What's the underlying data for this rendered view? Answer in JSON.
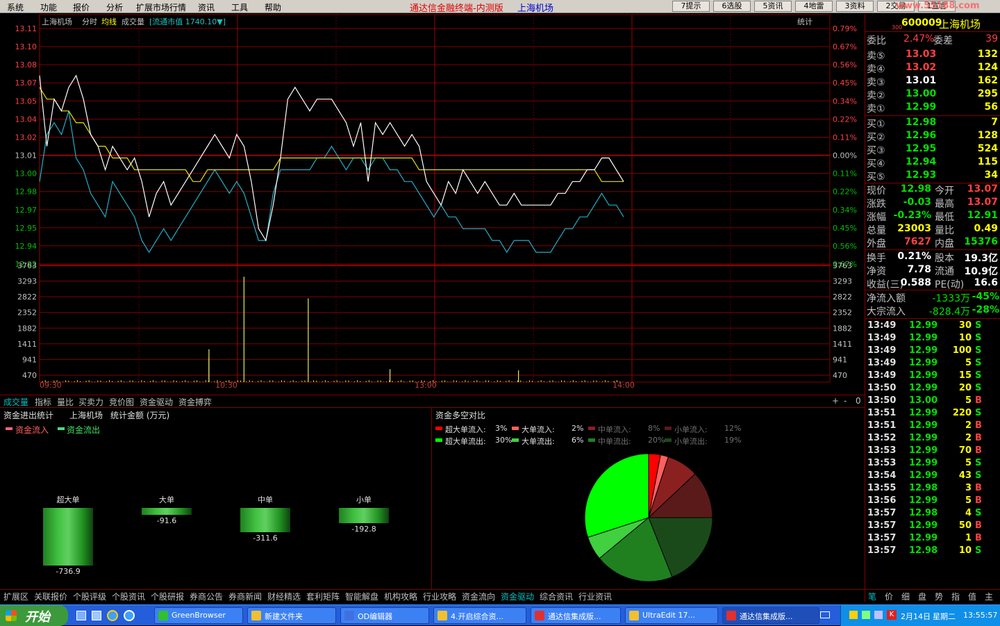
{
  "menu": [
    "系统",
    "功能",
    "报价",
    "分析",
    "扩展市场行情",
    "资讯",
    "工具",
    "帮助"
  ],
  "app_title": "通达信金融终端-内测版",
  "app_stock": "上海机场",
  "toolbar_buttons": [
    "7提示",
    "6选股",
    "5资讯",
    "4地雷",
    "3资料",
    "2交易",
    "1宣言"
  ],
  "watermark": "www.55188.com",
  "chart_header": {
    "name": "上海机场",
    "mode": "分时",
    "avg": "均线",
    "vol": "成交量",
    "mktcap": "[流通市值 1740.10▼]",
    "stat": "统计"
  },
  "chart_data": {
    "type": "line",
    "price_ticks_left": [
      "13.11",
      "13.10",
      "13.08",
      "13.07",
      "13.05",
      "13.04",
      "13.02",
      "13.01",
      "13.00",
      "12.98",
      "12.97",
      "12.95",
      "12.94",
      "12.92"
    ],
    "pct_ticks_right": [
      "0.79%",
      "0.67%",
      "0.56%",
      "0.45%",
      "0.34%",
      "0.22%",
      "0.11%",
      "0.00%",
      "0.11%",
      "0.22%",
      "0.34%",
      "0.45%",
      "0.56%",
      "0.67%"
    ],
    "vol_ticks": [
      "3763",
      "3293",
      "2822",
      "2352",
      "1882",
      "1411",
      "941",
      "470"
    ],
    "time_ticks": [
      "09:30",
      "10:30",
      "13:00",
      "14:00"
    ],
    "ylim": [
      12.91,
      13.11
    ],
    "ref_price": 13.01,
    "vol_max": 3763,
    "price_series": [
      13.07,
      13.01,
      13.05,
      13.04,
      13.06,
      13.07,
      13.05,
      13.02,
      13.01,
      12.99,
      13.01,
      13.0,
      12.99,
      13.0,
      12.98,
      12.95,
      12.97,
      12.98,
      12.96,
      12.97,
      12.98,
      12.99,
      13.0,
      13.01,
      13.02,
      13.01,
      13.0,
      13.02,
      13.01,
      12.98,
      12.94,
      12.93,
      12.96,
      13.0,
      13.05,
      13.06,
      13.05,
      13.04,
      13.05,
      13.05,
      13.05,
      13.04,
      13.03,
      13.01,
      13.03,
      12.98,
      13.03,
      13.02,
      13.03,
      13.02,
      13.01,
      13.02,
      13.01,
      12.98,
      12.97,
      12.96,
      12.98,
      12.97,
      12.99,
      12.98,
      12.97,
      12.98,
      12.97,
      12.96,
      12.96,
      12.97,
      12.96,
      12.96,
      12.96,
      12.96,
      12.96,
      12.97,
      12.97,
      12.98,
      12.98,
      12.99,
      12.99,
      13.0,
      13.0,
      12.99,
      12.98
    ],
    "avg_series": [
      13.06,
      13.05,
      13.05,
      13.04,
      13.04,
      13.03,
      13.03,
      13.02,
      13.01,
      13.01,
      13.0,
      13.0,
      13.0,
      12.99,
      12.99,
      12.99,
      12.99,
      12.99,
      12.99,
      12.99,
      12.99,
      12.98,
      12.98,
      12.99,
      12.99,
      12.99,
      12.99,
      12.99,
      12.99,
      12.99,
      12.99,
      12.99,
      12.99,
      13.0,
      13.0,
      13.0,
      13.0,
      13.0,
      13.0,
      13.0,
      13.0,
      13.0,
      13.0,
      13.0,
      13.0,
      13.0,
      13.0,
      13.0,
      13.0,
      13.0,
      13.0,
      13.0,
      12.99,
      12.99,
      12.99,
      12.99,
      12.99,
      12.99,
      12.99,
      12.99,
      12.99,
      12.99,
      12.99,
      12.99,
      12.99,
      12.99,
      12.99,
      12.99,
      12.99,
      12.99,
      12.99,
      12.99,
      12.99,
      12.99,
      12.99,
      12.99,
      12.99,
      12.98,
      12.98,
      12.98,
      12.98
    ],
    "leading_series": [
      12.98,
      13.02,
      13.03,
      13.02,
      13.04,
      13.0,
      12.99,
      12.97,
      12.96,
      12.95,
      12.98,
      12.97,
      12.96,
      12.95,
      12.93,
      12.92,
      12.93,
      12.94,
      12.93,
      12.94,
      12.95,
      12.96,
      12.97,
      12.98,
      12.99,
      12.98,
      12.97,
      12.98,
      12.97,
      12.95,
      12.93,
      12.93,
      12.97,
      12.99,
      12.99,
      12.99,
      12.99,
      12.99,
      13.0,
      13.0,
      13.01,
      13.0,
      12.99,
      13.0,
      13.0,
      12.99,
      13.0,
      13.0,
      12.99,
      12.99,
      12.98,
      12.98,
      12.97,
      12.96,
      12.95,
      12.96,
      12.95,
      12.95,
      12.94,
      12.94,
      12.94,
      12.94,
      12.93,
      12.93,
      12.92,
      12.93,
      12.93,
      12.93,
      12.92,
      12.92,
      12.92,
      12.93,
      12.94,
      12.94,
      12.95,
      12.95,
      12.96,
      12.97,
      12.96,
      12.96,
      12.95
    ],
    "volume_spikes": [
      [
        0.29,
        780
      ],
      [
        0.35,
        3400
      ],
      [
        0.46,
        2700
      ],
      [
        0.29,
        1060
      ],
      [
        0.6,
        420
      ],
      [
        0.82,
        380
      ]
    ]
  },
  "sub_tabs": [
    "成交量",
    "指标",
    "量比",
    "买卖力",
    "竞价图",
    "资金驱动",
    "资金搏弈"
  ],
  "sub_ctrl": [
    "+",
    "-",
    "0"
  ],
  "fund_left": {
    "title": "资金进出统计",
    "stock": "上海机场",
    "unit": "统计金额 (万元)",
    "legend_in": "资金流入",
    "legend_out": "资金流出",
    "bars": [
      {
        "label": "超大单",
        "value": "-736.9",
        "v": 736.9
      },
      {
        "label": "大单",
        "value": "-91.6",
        "v": 91.6
      },
      {
        "label": "中单",
        "value": "-311.6",
        "v": 311.6
      },
      {
        "label": "小单",
        "value": "-192.8",
        "v": 192.8
      }
    ]
  },
  "fund_right": {
    "title": "资金多空对比",
    "legend": [
      {
        "label": "超大单流入:",
        "pct": "3%",
        "color": "#ff0000"
      },
      {
        "label": "大单流入:",
        "pct": "2%",
        "color": "#ff6060"
      },
      {
        "label": "中单流入:",
        "pct": "8%",
        "color": "#8b2020"
      },
      {
        "label": "小单流入:",
        "pct": "12%",
        "color": "#5a1a1a"
      },
      {
        "label": "超大单流出:",
        "pct": "30%",
        "color": "#00ff00"
      },
      {
        "label": "大单流出:",
        "pct": "6%",
        "color": "#40d040"
      },
      {
        "label": "中单流出:",
        "pct": "20%",
        "color": "#208020"
      },
      {
        "label": "小单流出:",
        "pct": "19%",
        "color": "#1a4a1a"
      }
    ],
    "pie": [
      3,
      2,
      8,
      12,
      19,
      20,
      6,
      30
    ]
  },
  "bottom_tabs": [
    "扩展区",
    "关联报价",
    "个股评级",
    "个股资讯",
    "个股研报",
    "券商公告",
    "券商新闻",
    "财经精选",
    "套利矩阵",
    "智能解盘",
    "机构攻略",
    "行业攻略",
    "资金流向",
    "资金驱动",
    "综合资讯",
    "行业资讯"
  ],
  "side": {
    "code": "600009",
    "name": "上海机场",
    "sub": "300",
    "wb_label": "委比",
    "wb": "2.47%",
    "wc_label": "委差",
    "wc": "39",
    "asks": [
      [
        "卖⑤",
        "13.03",
        "132"
      ],
      [
        "卖④",
        "13.02",
        "124"
      ],
      [
        "卖③",
        "13.01",
        "162"
      ],
      [
        "卖②",
        "13.00",
        "295"
      ],
      [
        "卖①",
        "12.99",
        "56"
      ]
    ],
    "bids": [
      [
        "买①",
        "12.98",
        "7"
      ],
      [
        "买②",
        "12.96",
        "128"
      ],
      [
        "买③",
        "12.95",
        "524"
      ],
      [
        "买④",
        "12.94",
        "115"
      ],
      [
        "买⑤",
        "12.93",
        "34"
      ]
    ],
    "stats": [
      [
        "现价",
        "12.98",
        "今开",
        "13.07"
      ],
      [
        "涨跌",
        "-0.03",
        "最高",
        "13.07"
      ],
      [
        "涨幅",
        "-0.23%",
        "最低",
        "12.91"
      ],
      [
        "总量",
        "23003",
        "量比",
        "0.49"
      ],
      [
        "外盘",
        "7627",
        "内盘",
        "15376"
      ],
      [
        "换手",
        "0.21%",
        "股本",
        "19.3亿"
      ],
      [
        "净资",
        "7.78",
        "流通",
        "10.9亿"
      ],
      [
        "收益(三)",
        "0.588",
        "PE(动)",
        "16.6"
      ]
    ],
    "flow": [
      [
        "净流入额",
        "-1333万",
        "-45%"
      ],
      [
        "大宗流入",
        "-828.4万",
        "-28%"
      ]
    ],
    "ticks": [
      [
        "13:49",
        "12.99",
        "30",
        "S"
      ],
      [
        "13:49",
        "12.99",
        "10",
        "S"
      ],
      [
        "13:49",
        "12.99",
        "100",
        "S"
      ],
      [
        "13:49",
        "12.99",
        "5",
        "S"
      ],
      [
        "13:49",
        "12.99",
        "15",
        "S"
      ],
      [
        "13:50",
        "12.99",
        "20",
        "S"
      ],
      [
        "13:50",
        "13.00",
        "5",
        "B"
      ],
      [
        "13:51",
        "12.99",
        "220",
        "S"
      ],
      [
        "13:51",
        "12.99",
        "2",
        "B"
      ],
      [
        "13:52",
        "12.99",
        "2",
        "B"
      ],
      [
        "13:53",
        "12.99",
        "70",
        "B"
      ],
      [
        "13:53",
        "12.99",
        "5",
        "S"
      ],
      [
        "13:54",
        "12.99",
        "43",
        "S"
      ],
      [
        "13:55",
        "12.98",
        "3",
        "B"
      ],
      [
        "13:56",
        "12.99",
        "5",
        "B"
      ],
      [
        "13:57",
        "12.98",
        "4",
        "S"
      ],
      [
        "13:57",
        "12.99",
        "50",
        "B"
      ],
      [
        "13:57",
        "12.99",
        "1",
        "B"
      ],
      [
        "13:57",
        "12.98",
        "10",
        "S"
      ]
    ],
    "tabs": [
      "笔",
      "价",
      "细",
      "盘",
      "势",
      "指",
      "值",
      "主"
    ]
  },
  "taskbar": {
    "start": "开始",
    "tasks": [
      "GreenBrowser",
      "新建文件夹",
      "OD编辑器",
      "4.开启综合资...",
      "通达信集成版...",
      "UltraEdit 17...",
      "通达信集成版..."
    ],
    "date": "2月14日",
    "weekday": "星期二",
    "time": "13:55:57"
  }
}
